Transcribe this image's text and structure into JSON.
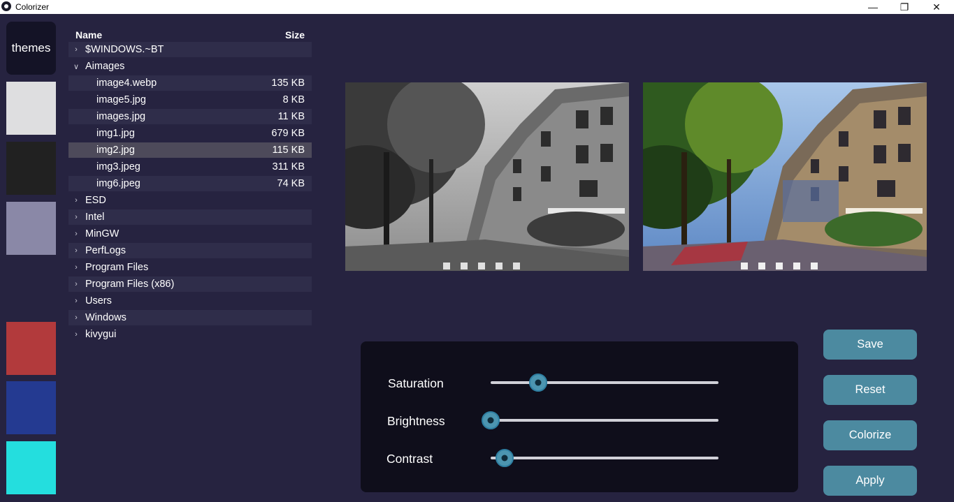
{
  "window": {
    "title": "Colorizer",
    "controls": {
      "minimize": "—",
      "maximize": "❐",
      "close": "✕"
    }
  },
  "themes": {
    "label": "themes",
    "swatches": [
      {
        "name": "light-gray",
        "color": "#dedee0"
      },
      {
        "name": "dark",
        "color": "#212121"
      },
      {
        "name": "lavender",
        "color": "#8a88a7"
      },
      {
        "name": "navy",
        "color": "#262340"
      },
      {
        "name": "red",
        "color": "#b23a3c"
      },
      {
        "name": "blue",
        "color": "#243a91"
      },
      {
        "name": "cyan",
        "color": "#24dede"
      }
    ]
  },
  "file_tree": {
    "header": {
      "name": "Name",
      "size": "Size"
    },
    "rows": [
      {
        "type": "folder",
        "name": "$WINDOWS.~BT",
        "expanded": false,
        "size": ""
      },
      {
        "type": "folder",
        "name": "Aimages",
        "expanded": true,
        "size": ""
      },
      {
        "type": "file",
        "name": "image4.webp",
        "size": "135 KB"
      },
      {
        "type": "file",
        "name": "image5.jpg",
        "size": "8 KB"
      },
      {
        "type": "file",
        "name": "images.jpg",
        "size": "11 KB"
      },
      {
        "type": "file",
        "name": "img1.jpg",
        "size": "679 KB"
      },
      {
        "type": "file",
        "name": "img2.jpg",
        "size": "115 KB",
        "selected": true
      },
      {
        "type": "file",
        "name": "img3.jpeg",
        "size": "311 KB"
      },
      {
        "type": "file",
        "name": "img6.jpeg",
        "size": "74 KB"
      },
      {
        "type": "folder",
        "name": "ESD",
        "expanded": false,
        "size": ""
      },
      {
        "type": "folder",
        "name": "Intel",
        "expanded": false,
        "size": ""
      },
      {
        "type": "folder",
        "name": "MinGW",
        "expanded": false,
        "size": ""
      },
      {
        "type": "folder",
        "name": "PerfLogs",
        "expanded": false,
        "size": ""
      },
      {
        "type": "folder",
        "name": "Program Files",
        "expanded": false,
        "size": ""
      },
      {
        "type": "folder",
        "name": "Program Files (x86)",
        "expanded": false,
        "size": ""
      },
      {
        "type": "folder",
        "name": "Users",
        "expanded": false,
        "size": ""
      },
      {
        "type": "folder",
        "name": "Windows",
        "expanded": false,
        "size": ""
      },
      {
        "type": "folder",
        "name": "kivygui",
        "expanded": false,
        "size": ""
      }
    ]
  },
  "sliders": [
    {
      "label": "Saturation",
      "value": 0.21
    },
    {
      "label": "Brightness",
      "value": 0.0
    },
    {
      "label": "Contrast",
      "value": 0.06
    }
  ],
  "actions": {
    "save": "Save",
    "reset": "Reset",
    "colorize": "Colorize",
    "apply": "Apply"
  }
}
